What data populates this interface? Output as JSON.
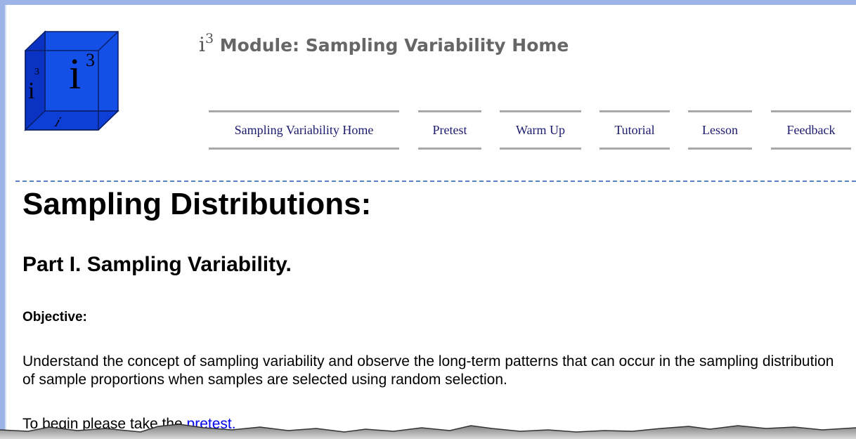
{
  "header": {
    "logo_text": "i3",
    "module_prefix_base": "i",
    "module_prefix_sup": "3",
    "module_title": "Module: Sampling Variability Home"
  },
  "nav": {
    "items": [
      {
        "label": "Sampling Variability Home"
      },
      {
        "label": "Pretest"
      },
      {
        "label": "Warm Up"
      },
      {
        "label": "Tutorial"
      },
      {
        "label": "Lesson"
      },
      {
        "label": "Feedback"
      }
    ]
  },
  "content": {
    "heading": "Sampling Distributions:",
    "subheading": "Part I.  Sampling Variability.",
    "objective_label": "Objective:",
    "objective_text": "Understand the concept of sampling variability and observe the long-term patterns that can occur in the sampling distribution of sample proportions when samples are selected using random selection.",
    "begin_text": "To begin please take the ",
    "begin_link": "pretest."
  },
  "colors": {
    "frame": "#9db4e6",
    "nav_text": "#1a1a6e",
    "divider": "#5b83c8",
    "link": "#0000ee",
    "logo_blue": "#0b3fd9"
  }
}
